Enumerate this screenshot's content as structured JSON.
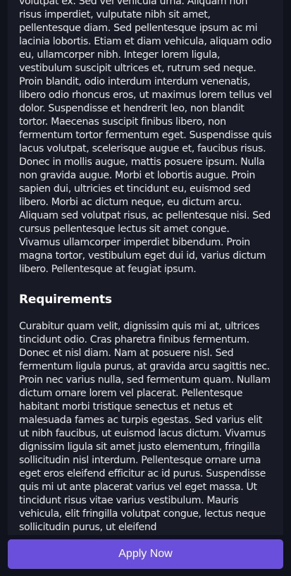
{
  "description": {
    "paragraph_1": "volutpat ex. Sed vel vehicula urna. Aliquam non risus imperdiet, vulputate nibh sit amet, pellentesque diam. Sed pellentesque ipsum ac mi lacinia lobortis. Etiam et diam vehicula, aliquam odio eu, ullamcorper nibh. Integer lorem ligula, vestibulum suscipit ultrices et, rutrum sed neque. Proin blandit, odio interdum interdum venenatis, libero odio rhoncus eros, ut maximus lorem tellus vel dolor. Suspendisse et hendrerit leo, non blandit tortor. Maecenas suscipit finibus libero, non fermentum tortor fermentum eget. Suspendisse quis lacus volutpat, scelerisque augue et, faucibus risus. Donec in mollis augue, mattis posuere ipsum. Nulla non gravida augue. Morbi et lobortis augue. Proin sapien dui, ultricies et tincidunt eu, euismod sed libero. Morbi ac dictum neque, eu dictum arcu. Aliquam sed volutpat risus, ac pellentesque nisi. Sed cursus pellentesque lectus sit amet congue. Vivamus ullamcorper imperdiet bibendum. Proin magna tortor, vestibulum eget dui id, varius dictum libero. Pellentesque at feugiat ipsum."
  },
  "requirements": {
    "heading": "Requirements",
    "paragraph": "Curabitur quam velit, dignissim quis mi at, ultrices tincidunt odio. Cras pharetra finibus fermentum. Donec et nisl diam. Nam at posuere nisl. Sed fermentum ligula purus, at gravida arcu sagittis nec. Proin nec varius nulla, sed fermentum quam. Nullam dictum ornare lorem vel placerat. Pellentesque habitant morbi tristique senectus et netus et malesuada fames ac turpis egestas. Sed varius elit ut nibh faucibus, ut euismod lacus dictum. Vivamus dignissim ligula sit amet justo elementum, fringilla sollicitudin nisl interdum. Pellentesque ornare urna eget eros eleifend efficitur ac id purus. Suspendisse quis mi ut ante placerat varius vel eget massa. Ut tincidunt risus vitae varius vestibulum. Mauris vehicula, elit fringilla volutpat congue, lectus neque sollicitudin purus, ut eleifend"
  },
  "footer": {
    "apply_label": "Apply Now"
  },
  "colors": {
    "background": "#11131c",
    "panel": "#181b25",
    "accent": "#6a4fdc",
    "text": "#e6e6ea"
  }
}
